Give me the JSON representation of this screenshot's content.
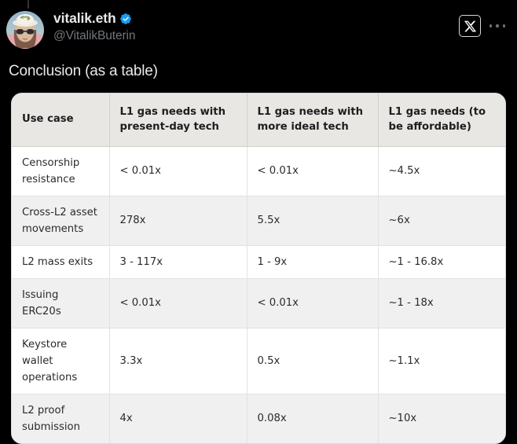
{
  "post": {
    "display_name": "vitalik.eth",
    "handle": "@VitalikButerin",
    "verified_badge_icon": "verified-badge-icon",
    "avatar_icon": "avatar-image",
    "text": "Conclusion (as a table)"
  },
  "header_actions": {
    "grok_badge_icon": "x-logo-badge-icon",
    "more_menu_icon": "more-options-icon"
  },
  "colors": {
    "background": "#000000",
    "text": "#e7e9ea",
    "muted_text": "#71767b",
    "verified_blue": "#1d9bf0",
    "table_header_bg": "#e9e7e4",
    "table_row_odd_bg": "#ffffff",
    "table_row_even_bg": "#f0f0f0",
    "table_text": "#2b2b2d"
  },
  "table": {
    "columns": [
      "Use case",
      "L1 gas needs with present-day tech",
      "L1 gas needs with more ideal tech",
      "L1 gas needs (to be affordable)"
    ],
    "rows": [
      {
        "use_case": "Censorship resistance",
        "present_day": "< 0.01x",
        "more_ideal": "< 0.01x",
        "affordable": "~4.5x"
      },
      {
        "use_case": "Cross-L2 asset movements",
        "present_day": "278x",
        "more_ideal": "5.5x",
        "affordable": "~6x"
      },
      {
        "use_case": "L2 mass exits",
        "present_day": "3 - 117x",
        "more_ideal": "1 - 9x",
        "affordable": "~1 - 16.8x"
      },
      {
        "use_case": "Issuing ERC20s",
        "present_day": "< 0.01x",
        "more_ideal": "< 0.01x",
        "affordable": "~1 - 18x"
      },
      {
        "use_case": "Keystore wallet operations",
        "present_day": "3.3x",
        "more_ideal": "0.5x",
        "affordable": "~1.1x"
      },
      {
        "use_case": "L2 proof submission",
        "present_day": "4x",
        "more_ideal": "0.08x",
        "affordable": "~10x"
      }
    ]
  }
}
